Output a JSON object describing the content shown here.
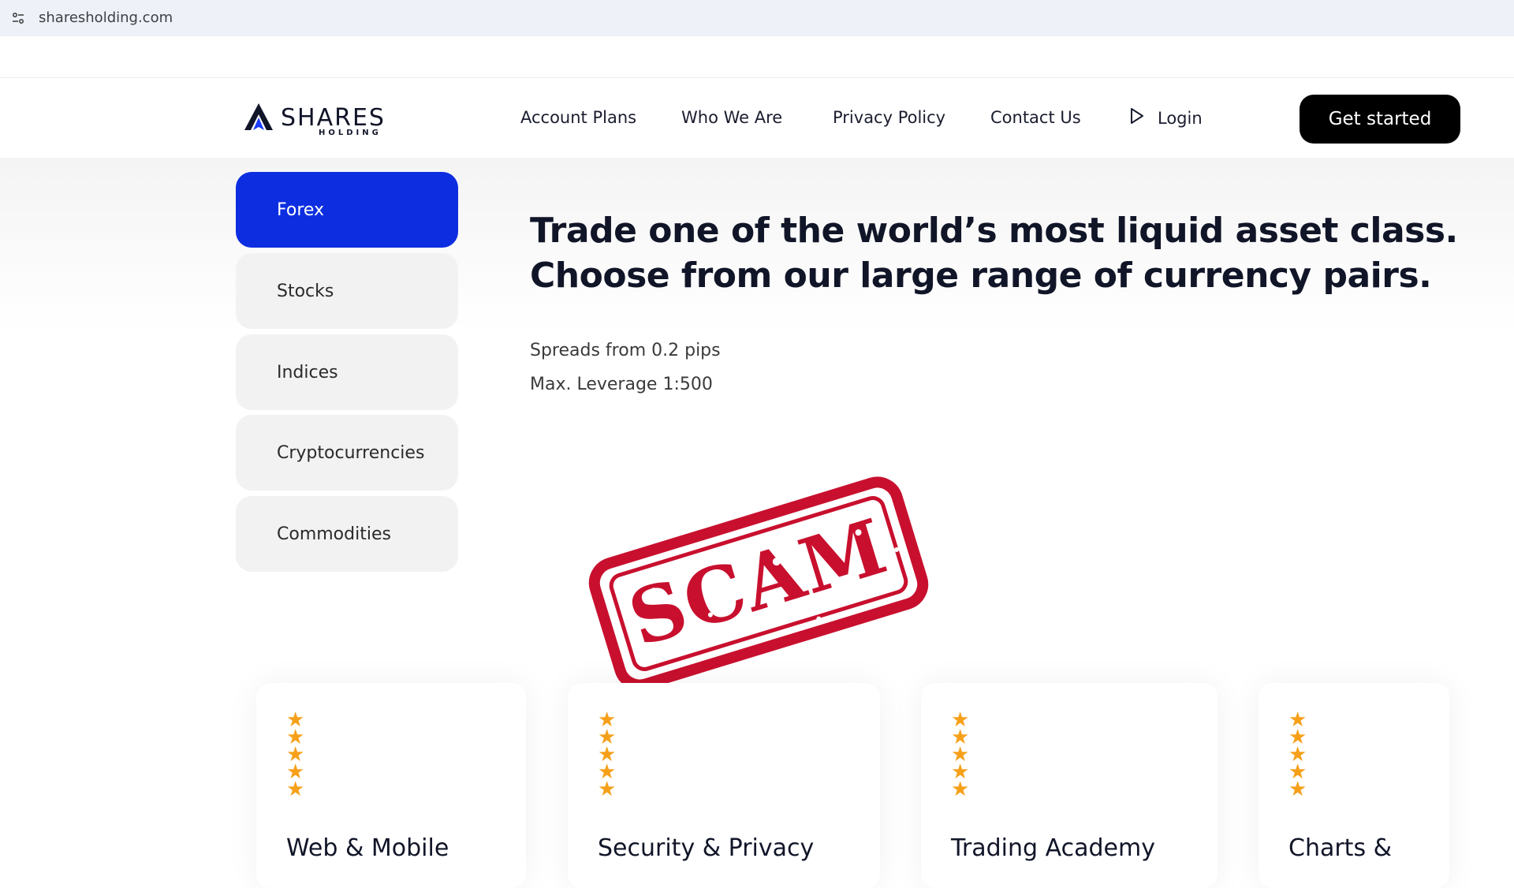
{
  "browser": {
    "url": "sharesholding.com",
    "site_info_icon": "tune-icon"
  },
  "header": {
    "logo": {
      "main": "SHARES",
      "sub": "HOLDING"
    },
    "nav": [
      "Account Plans",
      "Who We Are",
      "Privacy Policy",
      "Contact Us"
    ],
    "login_label": "Login",
    "login_icon": "play-outline-icon",
    "cta_label": "Get started"
  },
  "categories": [
    {
      "label": "Forex",
      "active": true
    },
    {
      "label": "Stocks",
      "active": false
    },
    {
      "label": "Indices",
      "active": false
    },
    {
      "label": "Cryptocurrencies",
      "active": false
    },
    {
      "label": "Commodities",
      "active": false
    }
  ],
  "content": {
    "headline": "Trade one of the world’s most liquid asset class. Choose from our large range of currency pairs.",
    "details": [
      "Spreads from 0.2 pips",
      "Max. Leverage 1:500"
    ]
  },
  "stamp": {
    "text": "SCAM",
    "color": "#c8102e"
  },
  "cards": [
    {
      "title": "Web & Mobile",
      "rating": 5
    },
    {
      "title": "Security & Privacy",
      "rating": 5
    },
    {
      "title": "Trading Academy",
      "rating": 5
    },
    {
      "title": "Charts &",
      "rating": 5
    }
  ],
  "colors": {
    "accent": "#0d2ee0",
    "star": "#f6a01a",
    "cta_bg": "#000000"
  }
}
